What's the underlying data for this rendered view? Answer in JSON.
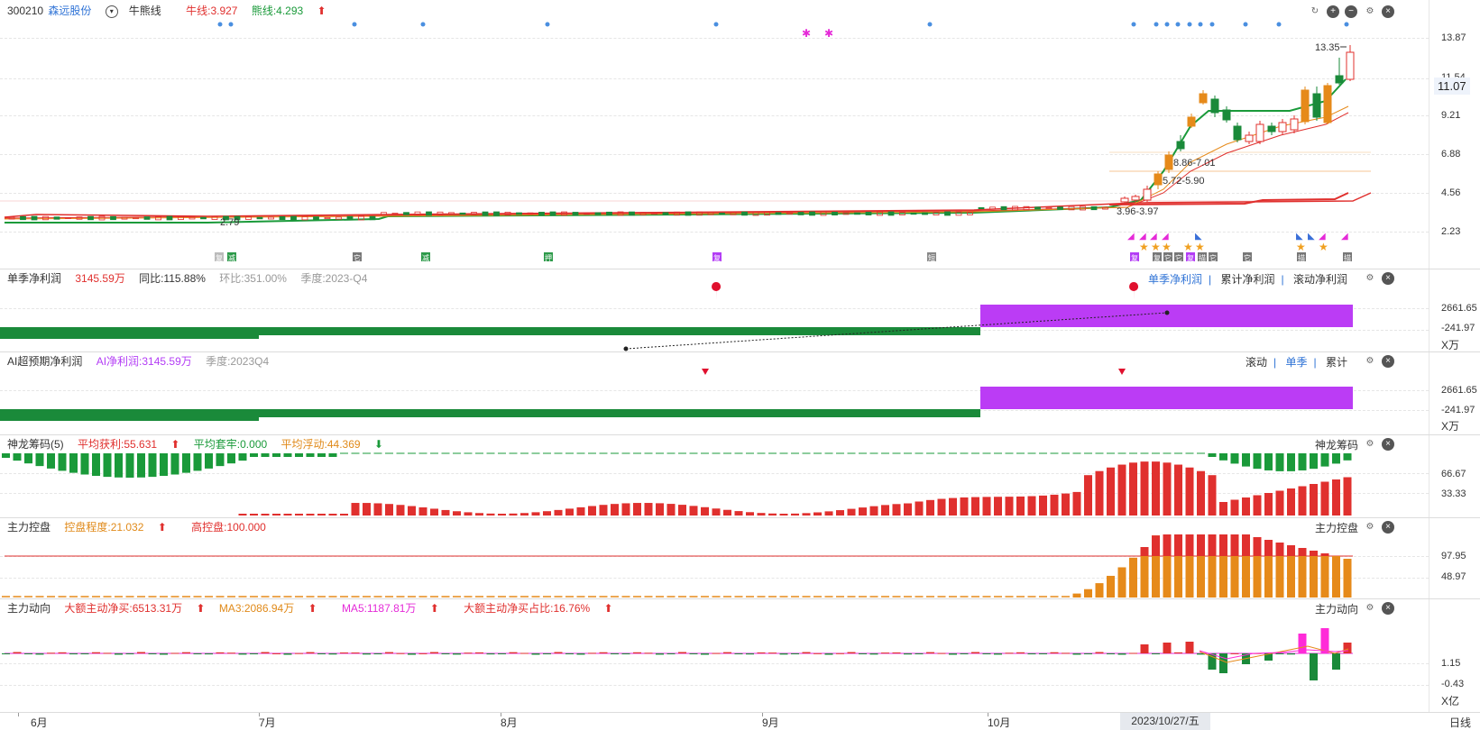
{
  "main": {
    "stock_code": "300210",
    "stock_name": "森远股份",
    "indicator": "牛熊线",
    "bull_label": "牛线:3.927",
    "bear_label": "熊线:4.293",
    "y_ticks": [
      "13.87",
      "11.54",
      "9.21",
      "6.88",
      "4.56",
      "2.23"
    ],
    "current_price": "11.07",
    "annotations": {
      "high": "13.35",
      "low": "2.79",
      "range1": "8.86-7.01",
      "range2": "5.72-5.90",
      "range3": "3.96-3.97"
    },
    "event_tags": [
      "复",
      "减",
      "它",
      "减",
      "押",
      "复",
      "短",
      "复",
      "复",
      "它",
      "它",
      "复",
      "描",
      "它",
      "它",
      "描",
      "描"
    ]
  },
  "panel_net_profit": {
    "title": "单季净利润",
    "value": "3145.59万",
    "yoy": "同比:115.88%",
    "qoq": "环比:351.00%",
    "quarter": "季度:2023-Q4",
    "tabs": [
      "单季净利润",
      "累计净利润",
      "滚动净利润"
    ],
    "y_ticks": [
      "2661.65",
      "-241.97"
    ],
    "unit": "X万"
  },
  "panel_ai_profit": {
    "title": "AI超预期净利润",
    "value": "AI净利润:3145.59万",
    "quarter": "季度:2023Q4",
    "tabs": [
      "滚动",
      "单季",
      "累计"
    ],
    "y_ticks": [
      "2661.65",
      "-241.97"
    ],
    "unit": "X万"
  },
  "panel_chips": {
    "title": "神龙筹码(5)",
    "avg_profit": "平均获利:55.631",
    "avg_trap": "平均套牢:0.000",
    "avg_float": "平均浮动:44.369",
    "right_title": "神龙筹码",
    "y_ticks": [
      "66.67",
      "33.33"
    ]
  },
  "panel_control": {
    "title": "主力控盘",
    "degree": "控盘程度:21.032",
    "high": "高控盘:100.000",
    "right_title": "主力控盘",
    "y_ticks": [
      "97.95",
      "48.97"
    ]
  },
  "panel_flow": {
    "title": "主力动向",
    "net_buy": "大额主动净买:6513.31万",
    "ma3": "MA3:2086.94万",
    "ma5": "MA5:1187.81万",
    "ratio": "大额主动净买占比:16.76%",
    "right_title": "主力动向",
    "y_ticks": [
      "1.15",
      "-0.43"
    ],
    "unit": "X亿"
  },
  "xaxis": {
    "months": [
      "6月",
      "7月",
      "8月",
      "9月",
      "10月"
    ],
    "current_date": "2023/10/27/五",
    "period": "日线"
  },
  "colors": {
    "up": "#e0302e",
    "down": "#1a8a3a",
    "orange": "#e68a1a",
    "purple": "#b33cf5",
    "magenta": "#ff2bd8"
  }
}
